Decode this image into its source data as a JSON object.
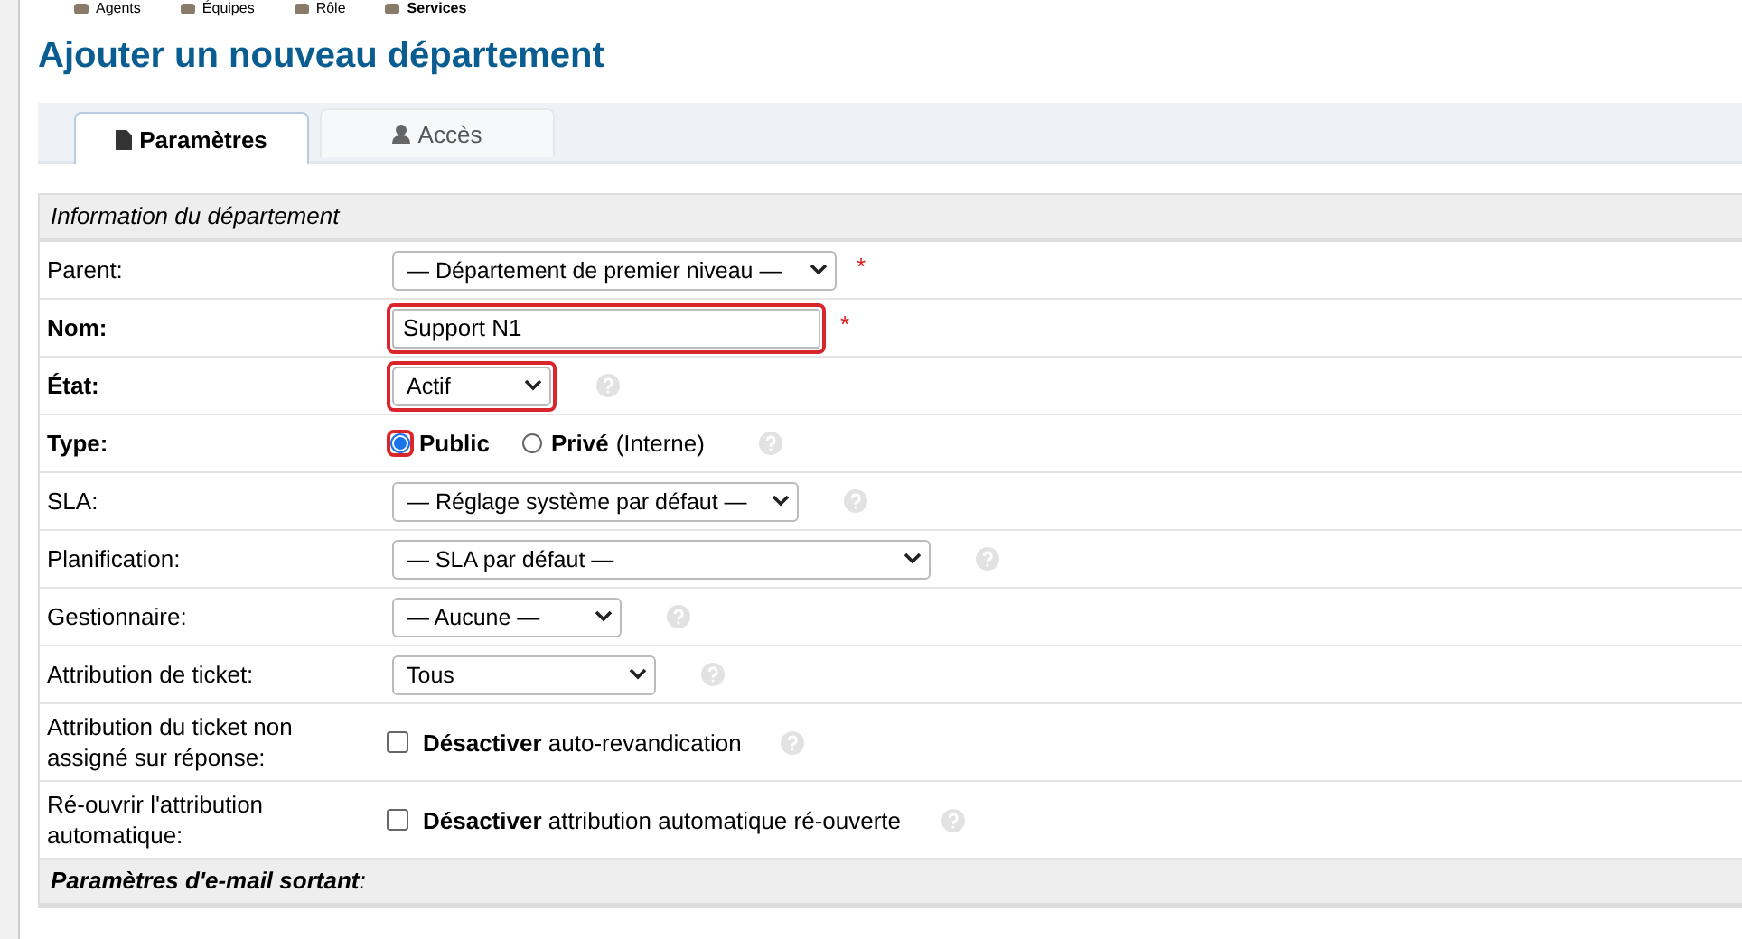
{
  "nav": [
    {
      "label": "Agents",
      "selected": false
    },
    {
      "label": "Équipes",
      "selected": false
    },
    {
      "label": "Rôle",
      "selected": false
    },
    {
      "label": "Services",
      "selected": true
    }
  ],
  "title": "Ajouter un nouveau département",
  "tabs": [
    {
      "label": "Paramètres",
      "selected": true
    },
    {
      "label": "Accès",
      "selected": false
    }
  ],
  "section": "Information du département",
  "rows": [
    {
      "kind": "select",
      "label": "Parent:",
      "bold": false,
      "value": "— Département de premier niveau —",
      "required_mark": "*",
      "help": false,
      "highlighted": false
    },
    {
      "kind": "input",
      "label": "Nom:",
      "bold": true,
      "value": "Support N1",
      "required_mark": "*",
      "help": false,
      "highlighted": true
    },
    {
      "kind": "select",
      "label": "État:",
      "bold": true,
      "value": "Actif",
      "help": true,
      "highlighted": true
    },
    {
      "kind": "radio",
      "label": "Type:",
      "bold": true,
      "help": true,
      "options": [
        {
          "label": "Public",
          "selected": true,
          "highlighted": true
        },
        {
          "label": "Privé",
          "note": "(Interne)",
          "selected": false,
          "highlighted": false
        }
      ]
    },
    {
      "kind": "select",
      "label": "SLA:",
      "bold": false,
      "value": "— Réglage système par défaut —",
      "help": true,
      "highlighted": false
    },
    {
      "kind": "select",
      "label": "Planification:",
      "bold": false,
      "value": "— SLA par défaut —",
      "help": true,
      "highlighted": false
    },
    {
      "kind": "select",
      "label": "Gestionnaire:",
      "bold": false,
      "value": "— Aucune —",
      "help": true,
      "highlighted": false
    },
    {
      "kind": "select",
      "label": "Attribution de ticket:",
      "bold": false,
      "value": "Tous",
      "help": true,
      "highlighted": false
    },
    {
      "kind": "checkbox",
      "label": "Attribution du ticket non assigné sur réponse:",
      "bold": false,
      "text": "**Désactiver** auto-revandication",
      "checked": false,
      "help": true
    },
    {
      "kind": "checkbox",
      "label": "Ré-ouvrir l'attribution automatique:",
      "bold": false,
      "text": "**Désactiver** attribution automatique ré-ouverte",
      "checked": false,
      "help": true
    }
  ],
  "section_2": "**Paramètres d'e-mail sortant**:"
}
